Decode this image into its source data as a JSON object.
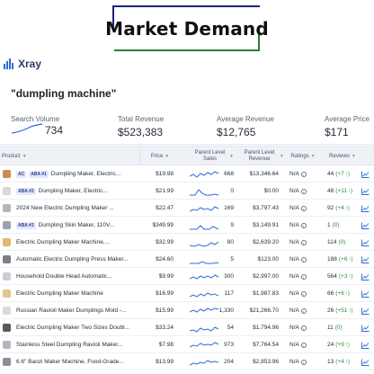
{
  "hero": {
    "title": "Market Demand"
  },
  "brand": {
    "name": "Xray",
    "color": "#2c6bd8"
  },
  "query": "\"dumpling machine\"",
  "stats": {
    "search_volume": {
      "label": "Search Volume",
      "value": "734"
    },
    "total_revenue": {
      "label": "Total Revenue",
      "value": "$523,383"
    },
    "average_revenue": {
      "label": "Average Revenue",
      "value": "$12,765"
    },
    "average_price": {
      "label": "Average Price",
      "value": "$171"
    }
  },
  "columns": {
    "product": "Product",
    "price": "Price",
    "sales": "Parent Level Sales",
    "revenue": "Parent Level Revenue",
    "ratings": "Ratings",
    "reviews": "Reviews"
  },
  "rows": [
    {
      "badges": [
        "AC",
        "ABA #1"
      ],
      "name": "Dumpling Maker, Electric...",
      "price": "$19.98",
      "sales": "668",
      "revenue": "$13,346.64",
      "rating": "N/A",
      "reviews": "44",
      "review_change": "(+7",
      "thumb_color": "#c98d4e"
    },
    {
      "badges": [
        "ABA #2"
      ],
      "name": "Dumpling Maker,  Electric...",
      "price": "$21.99",
      "sales": "0",
      "revenue": "$0.00",
      "rating": "N/A",
      "reviews": "48",
      "review_change": "(+11",
      "thumb_color": "#d8d8d8"
    },
    {
      "badges": [],
      "name": "2024 New Electric  Dumpling Maker ...",
      "price": "$22.47",
      "sales": "169",
      "revenue": "$3,797.43",
      "rating": "N/A",
      "reviews": "92",
      "review_change": "(+4",
      "thumb_color": "#b6b6b6"
    },
    {
      "badges": [
        "ABA #3"
      ],
      "name": "Dumpling Skin Maker, 110V...",
      "price": "$349.99",
      "sales": "9",
      "revenue": "$3,149.91",
      "rating": "N/A",
      "reviews": "1",
      "review_change": "(0)",
      "thumb_color": "#9aa3ad"
    },
    {
      "badges": [],
      "name": "Electric Dumpling Maker Machine,...",
      "price": "$32.99",
      "sales": "80",
      "revenue": "$2,639.20",
      "rating": "N/A",
      "reviews": "114",
      "review_change": "(0)",
      "thumb_color": "#e3b86a"
    },
    {
      "badges": [],
      "name": "Automatic Electric Dumpling Press Maker...",
      "price": "$24.60",
      "sales": "5",
      "revenue": "$123.00",
      "rating": "N/A",
      "reviews": "188",
      "review_change": "(+6",
      "thumb_color": "#7a7f86"
    },
    {
      "badges": [],
      "name": "Household Double Head Automatic...",
      "price": "$9.99",
      "sales": "300",
      "revenue": "$2,997.00",
      "rating": "N/A",
      "reviews": "564",
      "review_change": "(+3",
      "thumb_color": "#c9cfd6"
    },
    {
      "badges": [],
      "name": "Electric Dumpling Maker Machine",
      "price": "$16.99",
      "sales": "117",
      "revenue": "$1,987.83",
      "rating": "N/A",
      "reviews": "66",
      "review_change": "(+6",
      "thumb_color": "#e0c58e"
    },
    {
      "badges": [],
      "name": "Russian Ravioli Maker Dumplings Mold -...",
      "price": "$15.99",
      "sales": "1,330",
      "revenue": "$21,266.70",
      "rating": "N/A",
      "reviews": "26",
      "review_change": "(+51",
      "thumb_color": "#d7dbe0"
    },
    {
      "badges": [],
      "name": "Electric Dumpling Maker Two Sizes Doubl...",
      "price": "$33.24",
      "sales": "54",
      "revenue": "$1,794.96",
      "rating": "N/A",
      "reviews": "11",
      "review_change": "(0)",
      "thumb_color": "#555a60"
    },
    {
      "badges": [],
      "name": "Stainless Steel Dumpling Ravioli Maker...",
      "price": "$7.98",
      "sales": "973",
      "revenue": "$7,764.54",
      "rating": "N/A",
      "reviews": "24",
      "review_change": "(+9",
      "thumb_color": "#b0b7bf"
    },
    {
      "badges": [],
      "name": "6.6\" Baozi Maker Machine, Food-Grade...",
      "price": "$13.99",
      "sales": "204",
      "revenue": "$2,853.96",
      "rating": "N/A",
      "reviews": "13",
      "review_change": "(+4",
      "thumb_color": "#8a8f96"
    }
  ],
  "colors": {
    "accent": "#2c6bd8",
    "positive": "#2e8b3a",
    "header_bg": "#eef1f6"
  },
  "icons": {
    "info": "info-icon",
    "trend": "trend-chart-icon",
    "up": "arrow-up-icon",
    "sparkline": "sparkline-icon"
  }
}
